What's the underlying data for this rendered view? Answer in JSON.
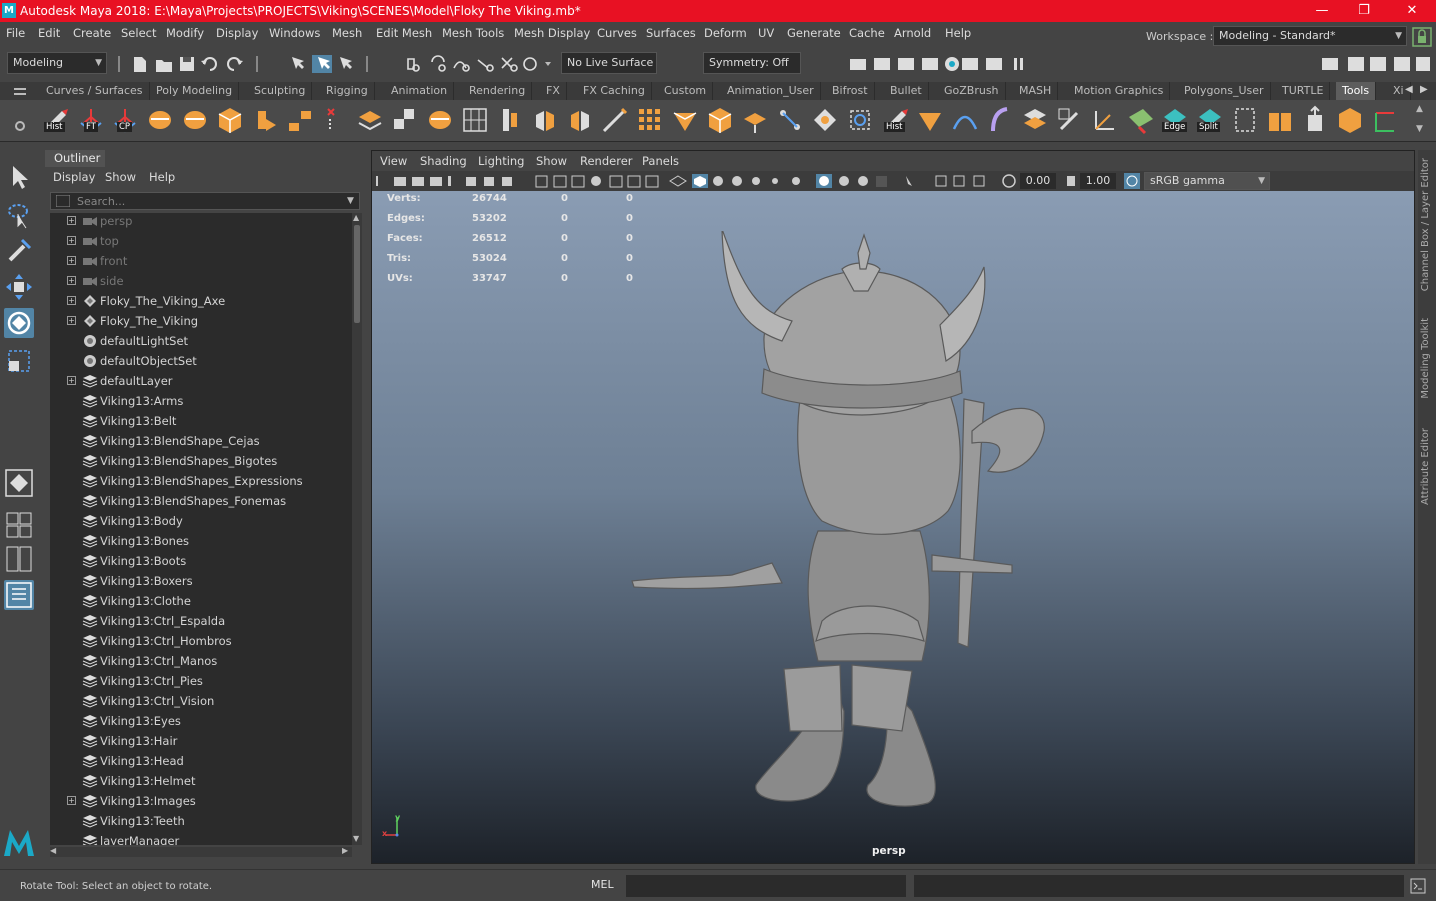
{
  "window": {
    "title": "Autodesk Maya 2018: E:\\Maya\\Projects\\PROJECTS\\Viking\\SCENES\\Model\\Floky The Viking.mb*",
    "logo_letter": "M",
    "minimize": "—",
    "maximize": "❐",
    "close": "✕"
  },
  "menubar": {
    "items": [
      "File",
      "Edit",
      "Create",
      "Select",
      "Modify",
      "Display",
      "Windows",
      "Mesh",
      "Edit Mesh",
      "Mesh Tools",
      "Mesh Display",
      "Curves",
      "Surfaces",
      "Deform",
      "UV",
      "Generate",
      "Cache",
      "Arnold",
      "Help"
    ],
    "workspace_label": "Workspace :",
    "workspace_value": "Modeling - Standard*"
  },
  "statusline": {
    "menuset": "Modeling",
    "live_surface": "No Live Surface",
    "symmetry": "Symmetry: Off"
  },
  "shelf": {
    "tabs": [
      "Curves / Surfaces",
      "Poly Modeling",
      "Sculpting",
      "Rigging",
      "Animation",
      "Rendering",
      "FX",
      "FX Caching",
      "Custom",
      "Animation_User",
      "Bifrost",
      "Bullet",
      "GoZBrush",
      "MASH",
      "Motion Graphics",
      "Polygons_User",
      "TURTLE",
      "Tools",
      "Xi"
    ],
    "active_tab": "Tools",
    "icon_labels": {
      "hist1": "Hist",
      "ft": "FT",
      "cp": "CP",
      "hist2": "Hist",
      "edge": "Edge",
      "split": "Split"
    }
  },
  "outliner": {
    "title": "Outliner",
    "menu": [
      "Display",
      "Show",
      "Help"
    ],
    "search_placeholder": "Search...",
    "rows": [
      {
        "label": "persp",
        "icon": "camera-icon",
        "expand": true,
        "dim": true
      },
      {
        "label": "top",
        "icon": "camera-icon",
        "expand": true,
        "dim": true
      },
      {
        "label": "front",
        "icon": "camera-icon",
        "expand": true,
        "dim": true
      },
      {
        "label": "side",
        "icon": "camera-icon",
        "expand": true,
        "dim": true
      },
      {
        "label": "Floky_The_Viking_Axe",
        "icon": "transform-icon",
        "expand": true,
        "dim": false
      },
      {
        "label": "Floky_The_Viking",
        "icon": "transform-icon",
        "expand": true,
        "dim": false
      },
      {
        "label": "defaultLightSet",
        "icon": "set-icon",
        "expand": false,
        "dim": false
      },
      {
        "label": "defaultObjectSet",
        "icon": "set-icon",
        "expand": false,
        "dim": false
      },
      {
        "label": "defaultLayer",
        "icon": "layer-icon",
        "expand": true,
        "dim": false
      },
      {
        "label": "Viking13:Arms",
        "icon": "layer-icon",
        "expand": false,
        "dim": false
      },
      {
        "label": "Viking13:Belt",
        "icon": "layer-icon",
        "expand": false,
        "dim": false
      },
      {
        "label": "Viking13:BlendShape_Cejas",
        "icon": "layer-icon",
        "expand": false,
        "dim": false
      },
      {
        "label": "Viking13:BlendShapes_Bigotes",
        "icon": "layer-icon",
        "expand": false,
        "dim": false
      },
      {
        "label": "Viking13:BlendShapes_Expressions",
        "icon": "layer-icon",
        "expand": false,
        "dim": false
      },
      {
        "label": "Viking13:BlendShapes_Fonemas",
        "icon": "layer-icon",
        "expand": false,
        "dim": false
      },
      {
        "label": "Viking13:Body",
        "icon": "layer-icon",
        "expand": false,
        "dim": false
      },
      {
        "label": "Viking13:Bones",
        "icon": "layer-icon",
        "expand": false,
        "dim": false
      },
      {
        "label": "Viking13:Boots",
        "icon": "layer-icon",
        "expand": false,
        "dim": false
      },
      {
        "label": "Viking13:Boxers",
        "icon": "layer-icon",
        "expand": false,
        "dim": false
      },
      {
        "label": "Viking13:Clothe",
        "icon": "layer-icon",
        "expand": false,
        "dim": false
      },
      {
        "label": "Viking13:Ctrl_Espalda",
        "icon": "layer-icon",
        "expand": false,
        "dim": false
      },
      {
        "label": "Viking13:Ctrl_Hombros",
        "icon": "layer-icon",
        "expand": false,
        "dim": false
      },
      {
        "label": "Viking13:Ctrl_Manos",
        "icon": "layer-icon",
        "expand": false,
        "dim": false
      },
      {
        "label": "Viking13:Ctrl_Pies",
        "icon": "layer-icon",
        "expand": false,
        "dim": false
      },
      {
        "label": "Viking13:Ctrl_Vision",
        "icon": "layer-icon",
        "expand": false,
        "dim": false
      },
      {
        "label": "Viking13:Eyes",
        "icon": "layer-icon",
        "expand": false,
        "dim": false
      },
      {
        "label": "Viking13:Hair",
        "icon": "layer-icon",
        "expand": false,
        "dim": false
      },
      {
        "label": "Viking13:Head",
        "icon": "layer-icon",
        "expand": false,
        "dim": false
      },
      {
        "label": "Viking13:Helmet",
        "icon": "layer-icon",
        "expand": false,
        "dim": false
      },
      {
        "label": "Viking13:Images",
        "icon": "layer-icon",
        "expand": true,
        "dim": false
      },
      {
        "label": "Viking13:Teeth",
        "icon": "layer-icon",
        "expand": false,
        "dim": false
      },
      {
        "label": "layerManager",
        "icon": "layer-icon",
        "expand": false,
        "dim": false
      }
    ]
  },
  "viewport": {
    "menu": [
      "View",
      "Shading",
      "Lighting",
      "Show",
      "Renderer",
      "Panels"
    ],
    "gamma_value": "0.00",
    "exposure_value": "1.00",
    "color_space": "sRGB gamma",
    "camera": "persp",
    "axis_y": "y",
    "axis_x": "x",
    "hud": [
      {
        "label": "Verts:",
        "total": "26744",
        "sel": "0",
        "comp": "0"
      },
      {
        "label": "Edges:",
        "total": "53202",
        "sel": "0",
        "comp": "0"
      },
      {
        "label": "Faces:",
        "total": "26512",
        "sel": "0",
        "comp": "0"
      },
      {
        "label": "Tris:",
        "total": "53024",
        "sel": "0",
        "comp": "0"
      },
      {
        "label": "UVs:",
        "total": "33747",
        "sel": "0",
        "comp": "0"
      }
    ]
  },
  "side_tabs": [
    "Channel Box / Layer Editor",
    "Modeling Toolkit",
    "Attribute Editor"
  ],
  "commandline": {
    "help_text": "Rotate Tool: Select an object to rotate.",
    "language": "MEL"
  },
  "colors": {
    "titlebar": "#e81123",
    "accent": "#5285a6",
    "shelf_orange": "#f0a040"
  }
}
